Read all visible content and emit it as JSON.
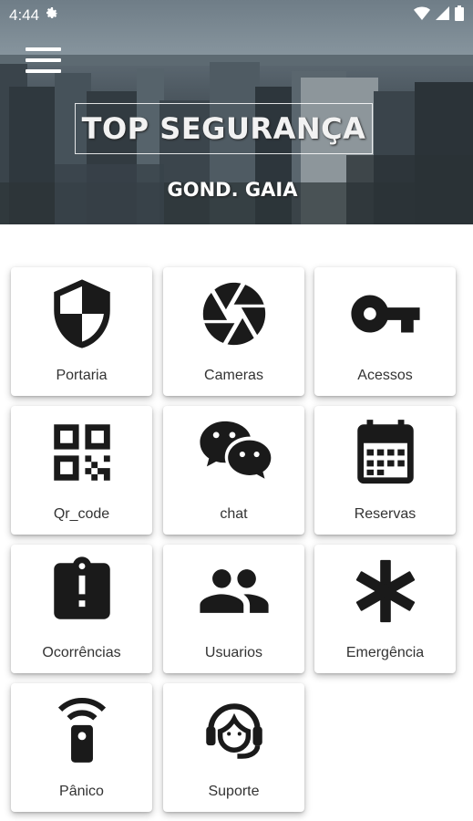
{
  "status_bar": {
    "time": "4:44"
  },
  "header": {
    "brand": "TOP SEGURANÇA",
    "subtitle": "GOND. GAIA"
  },
  "menu": [
    {
      "label": "Portaria",
      "icon": "shield-icon"
    },
    {
      "label": "Cameras",
      "icon": "camera-shutter-icon"
    },
    {
      "label": "Acessos",
      "icon": "key-icon"
    },
    {
      "label": "Qr_code",
      "icon": "qr-code-icon"
    },
    {
      "label": "chat",
      "icon": "chat-icon"
    },
    {
      "label": "Reservas",
      "icon": "calendar-icon"
    },
    {
      "label": "Ocorrências",
      "icon": "report-alert-icon"
    },
    {
      "label": "Usuarios",
      "icon": "users-icon"
    },
    {
      "label": "Emergência",
      "icon": "asterisk-icon"
    },
    {
      "label": "Pânico",
      "icon": "panic-remote-icon"
    },
    {
      "label": "Suporte",
      "icon": "support-headset-icon"
    }
  ],
  "colors": {
    "icon": "#1a1a1a",
    "label": "#333333",
    "background": "#ffffff"
  }
}
